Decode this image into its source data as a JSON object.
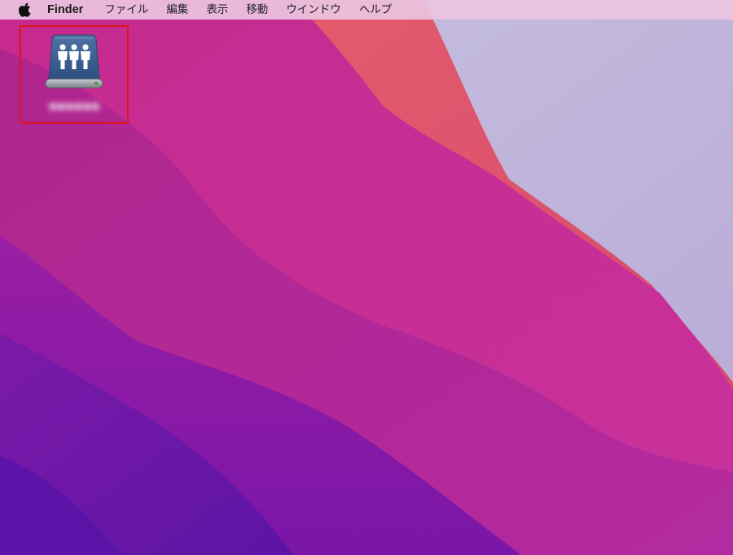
{
  "menubar": {
    "apple_icon": "apple-logo-icon",
    "app_name": "Finder",
    "items": [
      "ファイル",
      "編集",
      "表示",
      "移動",
      "ウインドウ",
      "ヘルプ"
    ]
  },
  "desktop": {
    "icon": {
      "type": "shared-network-drive-icon",
      "label": "●●●●●●",
      "selection_color": "#e0141e"
    }
  },
  "colors": {
    "menubar_bg": "#ecc4e2",
    "wallpaper_left": "#b02a9a",
    "wallpaper_peach": "#e05a6e",
    "wallpaper_lilac": "#c0b8dc",
    "wallpaper_violet": "#6a1aa6"
  }
}
